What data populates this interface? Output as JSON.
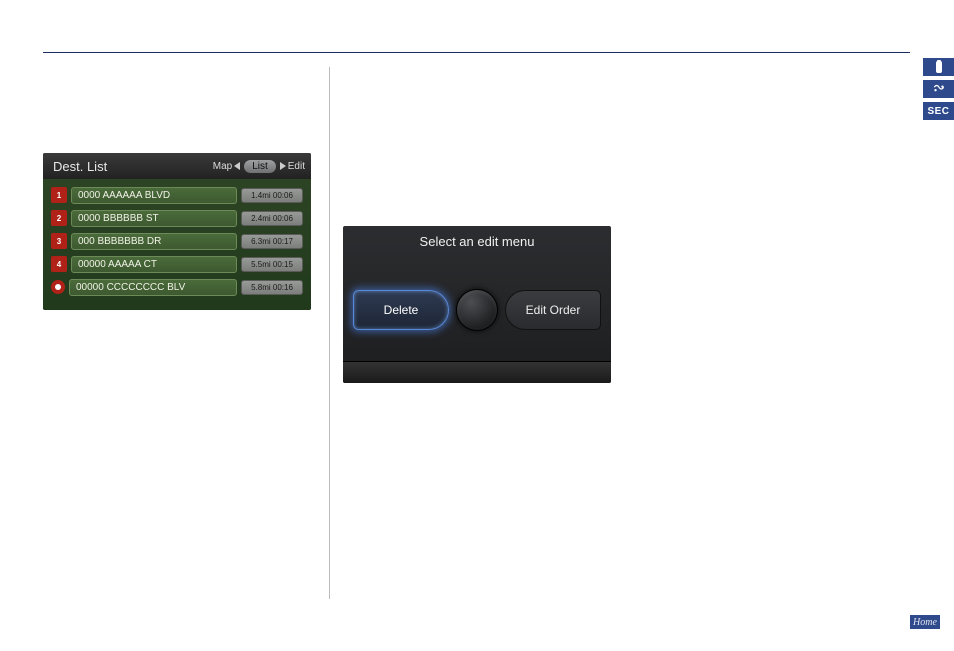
{
  "side_badges": {
    "sec_label": "SEC"
  },
  "home_label": "Home",
  "shot1": {
    "title": "Dest. List",
    "nav": {
      "map": "Map",
      "list": "List",
      "edit": "Edit"
    },
    "rows": [
      {
        "badge": "1",
        "name": "0000 AAAAAA BLVD",
        "meta": "1.4mi 00:06"
      },
      {
        "badge": "2",
        "name": "0000 BBBBBB ST",
        "meta": "2.4mi 00:06"
      },
      {
        "badge": "3",
        "name": "000 BBBBBBB DR",
        "meta": "6.3mi 00:17"
      },
      {
        "badge": "4",
        "name": "00000 AAAAA CT",
        "meta": "5.5mi 00:15"
      },
      {
        "badge": "final",
        "name": "00000 CCCCCCCC BLV",
        "meta": "5.8mi 00:16"
      }
    ]
  },
  "shot2": {
    "title": "Select an edit menu",
    "delete": "Delete",
    "edit_order": "Edit Order"
  }
}
